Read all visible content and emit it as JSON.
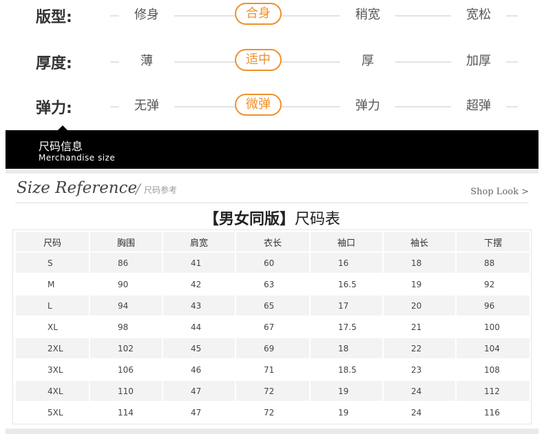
{
  "attributes": [
    {
      "label": "版型:",
      "options": [
        "修身",
        "合身",
        "稍宽",
        "宽松"
      ],
      "selected": 1
    },
    {
      "label": "厚度:",
      "options": [
        "薄",
        "适中",
        "厚",
        "加厚"
      ],
      "selected": 1
    },
    {
      "label": "弹力:",
      "options": [
        "无弹",
        "微弹",
        "弹力",
        "超弹"
      ],
      "selected": 1
    }
  ],
  "banner": {
    "title": "尺码信息",
    "subtitle": "Merchandise size"
  },
  "reference": {
    "title": "Size Reference",
    "separator": "/",
    "title_cn": "尺码参考",
    "shop_look": "Shop Look >"
  },
  "table": {
    "title_bracketed": "【男女同版】",
    "title_rest": "尺码表",
    "headers": [
      "尺码",
      "胸围",
      "肩宽",
      "衣长",
      "袖口",
      "袖长",
      "下摆"
    ],
    "rows": [
      [
        "S",
        "86",
        "41",
        "60",
        "16",
        "18",
        "88"
      ],
      [
        "M",
        "90",
        "42",
        "63",
        "16.5",
        "19",
        "92"
      ],
      [
        "L",
        "94",
        "43",
        "65",
        "17",
        "20",
        "96"
      ],
      [
        "XL",
        "98",
        "44",
        "67",
        "17.5",
        "21",
        "100"
      ],
      [
        "2XL",
        "102",
        "45",
        "69",
        "18",
        "22",
        "104"
      ],
      [
        "3XL",
        "106",
        "46",
        "71",
        "18.5",
        "23",
        "108"
      ],
      [
        "4XL",
        "110",
        "47",
        "72",
        "19",
        "24",
        "112"
      ],
      [
        "5XL",
        "114",
        "47",
        "72",
        "19",
        "24",
        "116"
      ]
    ]
  },
  "colors": {
    "accent": "#f0902a",
    "banner_bg": "#000000",
    "row_alt": "#f3f3f3"
  }
}
